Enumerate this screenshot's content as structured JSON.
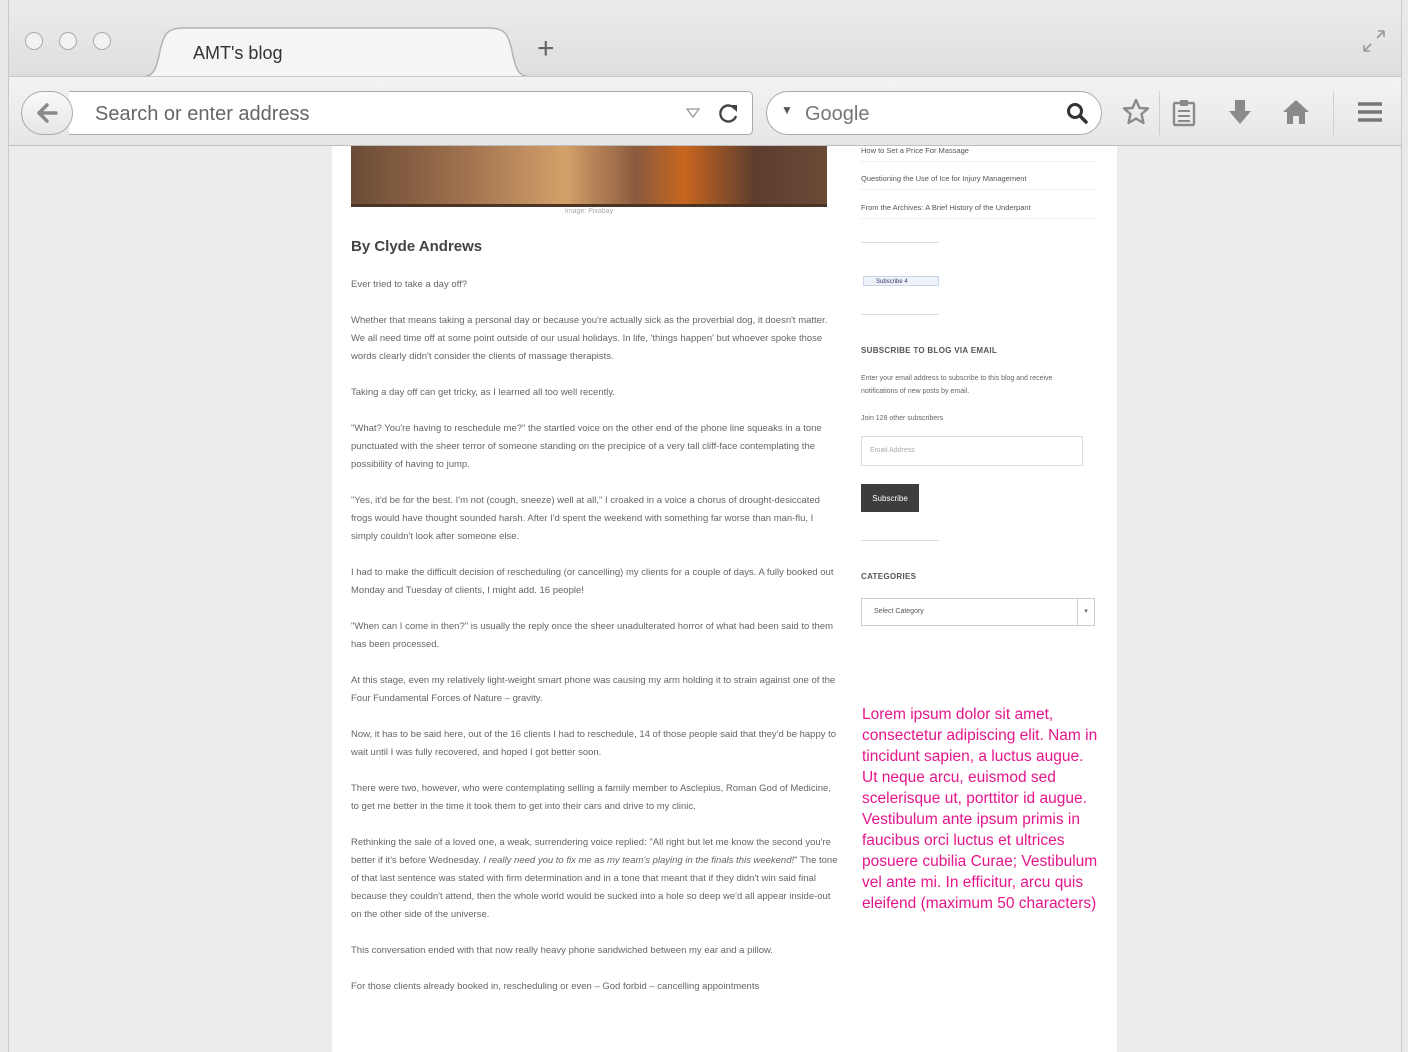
{
  "browser": {
    "tab_title": "AMT's blog",
    "address_placeholder": "Search or enter address",
    "search_engine": "Google",
    "search_placeholder": "Google"
  },
  "icons": {
    "back": "back-arrow-icon",
    "reload": "reload-icon",
    "search": "magnifier-icon",
    "bookmark": "star-icon",
    "reading_list": "clipboard-icon",
    "downloads": "download-arrow-icon",
    "home": "home-icon",
    "menu": "hamburger-icon",
    "fullscreen": "fullscreen-icon"
  },
  "post": {
    "image_caption": "Image: Pixabay",
    "author": "By Clyde Andrews",
    "paragraphs": [
      "Ever tried to take a day off?",
      "Whether that means taking a personal day or because you're actually sick as the proverbial dog, it doesn't matter. We all need time off at some point outside of our usual holidays. In life, 'things happen' but whoever spoke those words clearly didn't consider the clients of massage therapists.",
      "Taking a day off can get tricky, as I learned all too well recently.",
      "\"What? You're having to reschedule me?\" the startled voice on the other end of the phone line squeaks in a tone punctuated with the sheer terror of someone standing on the precipice of a very tall cliff-face contemplating the possibility of having to jump.",
      "\"Yes, it'd be for the best. I'm not (cough, sneeze) well at all,\" I croaked in a voice a chorus of drought-desiccated frogs would have thought sounded harsh. After I'd spent the weekend with something far worse than man-flu, I simply couldn't look after someone else.",
      "I had to make the difficult decision of rescheduling (or cancelling) my clients for a couple of days. A fully booked out Monday and Tuesday of clients, I might add. 16 people!",
      "\"When can I come in then?\" is usually the reply once the sheer unadulterated horror of what had been said to them has been processed.",
      "At this stage, even my relatively light-weight smart phone was causing my arm holding it to strain against one of the Four Fundamental Forces of Nature – gravity.",
      "Now, it has to be said here, out of the 16 clients I had to reschedule, 14 of those people said that they'd be happy to wait until I was fully recovered, and hoped I got better soon.",
      "There were two, however, who were contemplating selling a family member to Asclepius, Roman God of Medicine, to get me better in the time it took them to get into their cars and drive to my clinic."
    ],
    "p11_start": "Rethinking the sale of a loved one, a weak, surrendering voice replied: \"All right but let me know the second you're better if it's before Wednesday. ",
    "p11_em": "I really need you to fix me as my team's playing in the finals this weekend!",
    "p11_end": "\" The tone of that last sentence was stated with firm determination and in a tone that meant that if they didn't win said final because they couldn't attend, then the whole world would be sucked into a hole so deep we'd all appear inside-out on the other side of the universe.",
    "p12": "This conversation ended with that now really heavy phone sandwiched between my ear and a pillow.",
    "p13": "For those clients already booked in, rescheduling or even – God forbid – cancelling appointments"
  },
  "sidebar": {
    "links": [
      "How to Set a Price For Massage",
      "Questioning the Use of Ice for Injury Management",
      "From the Archives: A Brief History of the Underpant"
    ],
    "subscribe_badge": "Subscribe 4",
    "email_widget_title": "SUBSCRIBE TO BLOG VIA EMAIL",
    "email_widget_text": "Enter your email address to subscribe to this blog and receive notifications of new posts by email.",
    "subscribers_text": "Join 128 other subscribers",
    "email_placeholder": "Email Address",
    "subscribe_button": "Subscribe",
    "categories_title": "CATEGORIES",
    "category_select": "Select Category"
  },
  "annotation": "Lorem ipsum dolor sit amet, consectetur adipiscing elit. Nam in tincidunt sapien, a luctus augue. Ut neque arcu, euismod sed scelerisque ut, porttitor id augue. Vestibulum ante ipsum primis in faucibus orci luctus et ultrices posuere cubilia Curae; Vestibulum vel ante mi. In efficitur, arcu quis eleifend (maximum 50 characters)",
  "colors": {
    "annotation": "#e4168b",
    "subscribe_button": "#3d3d3d"
  }
}
